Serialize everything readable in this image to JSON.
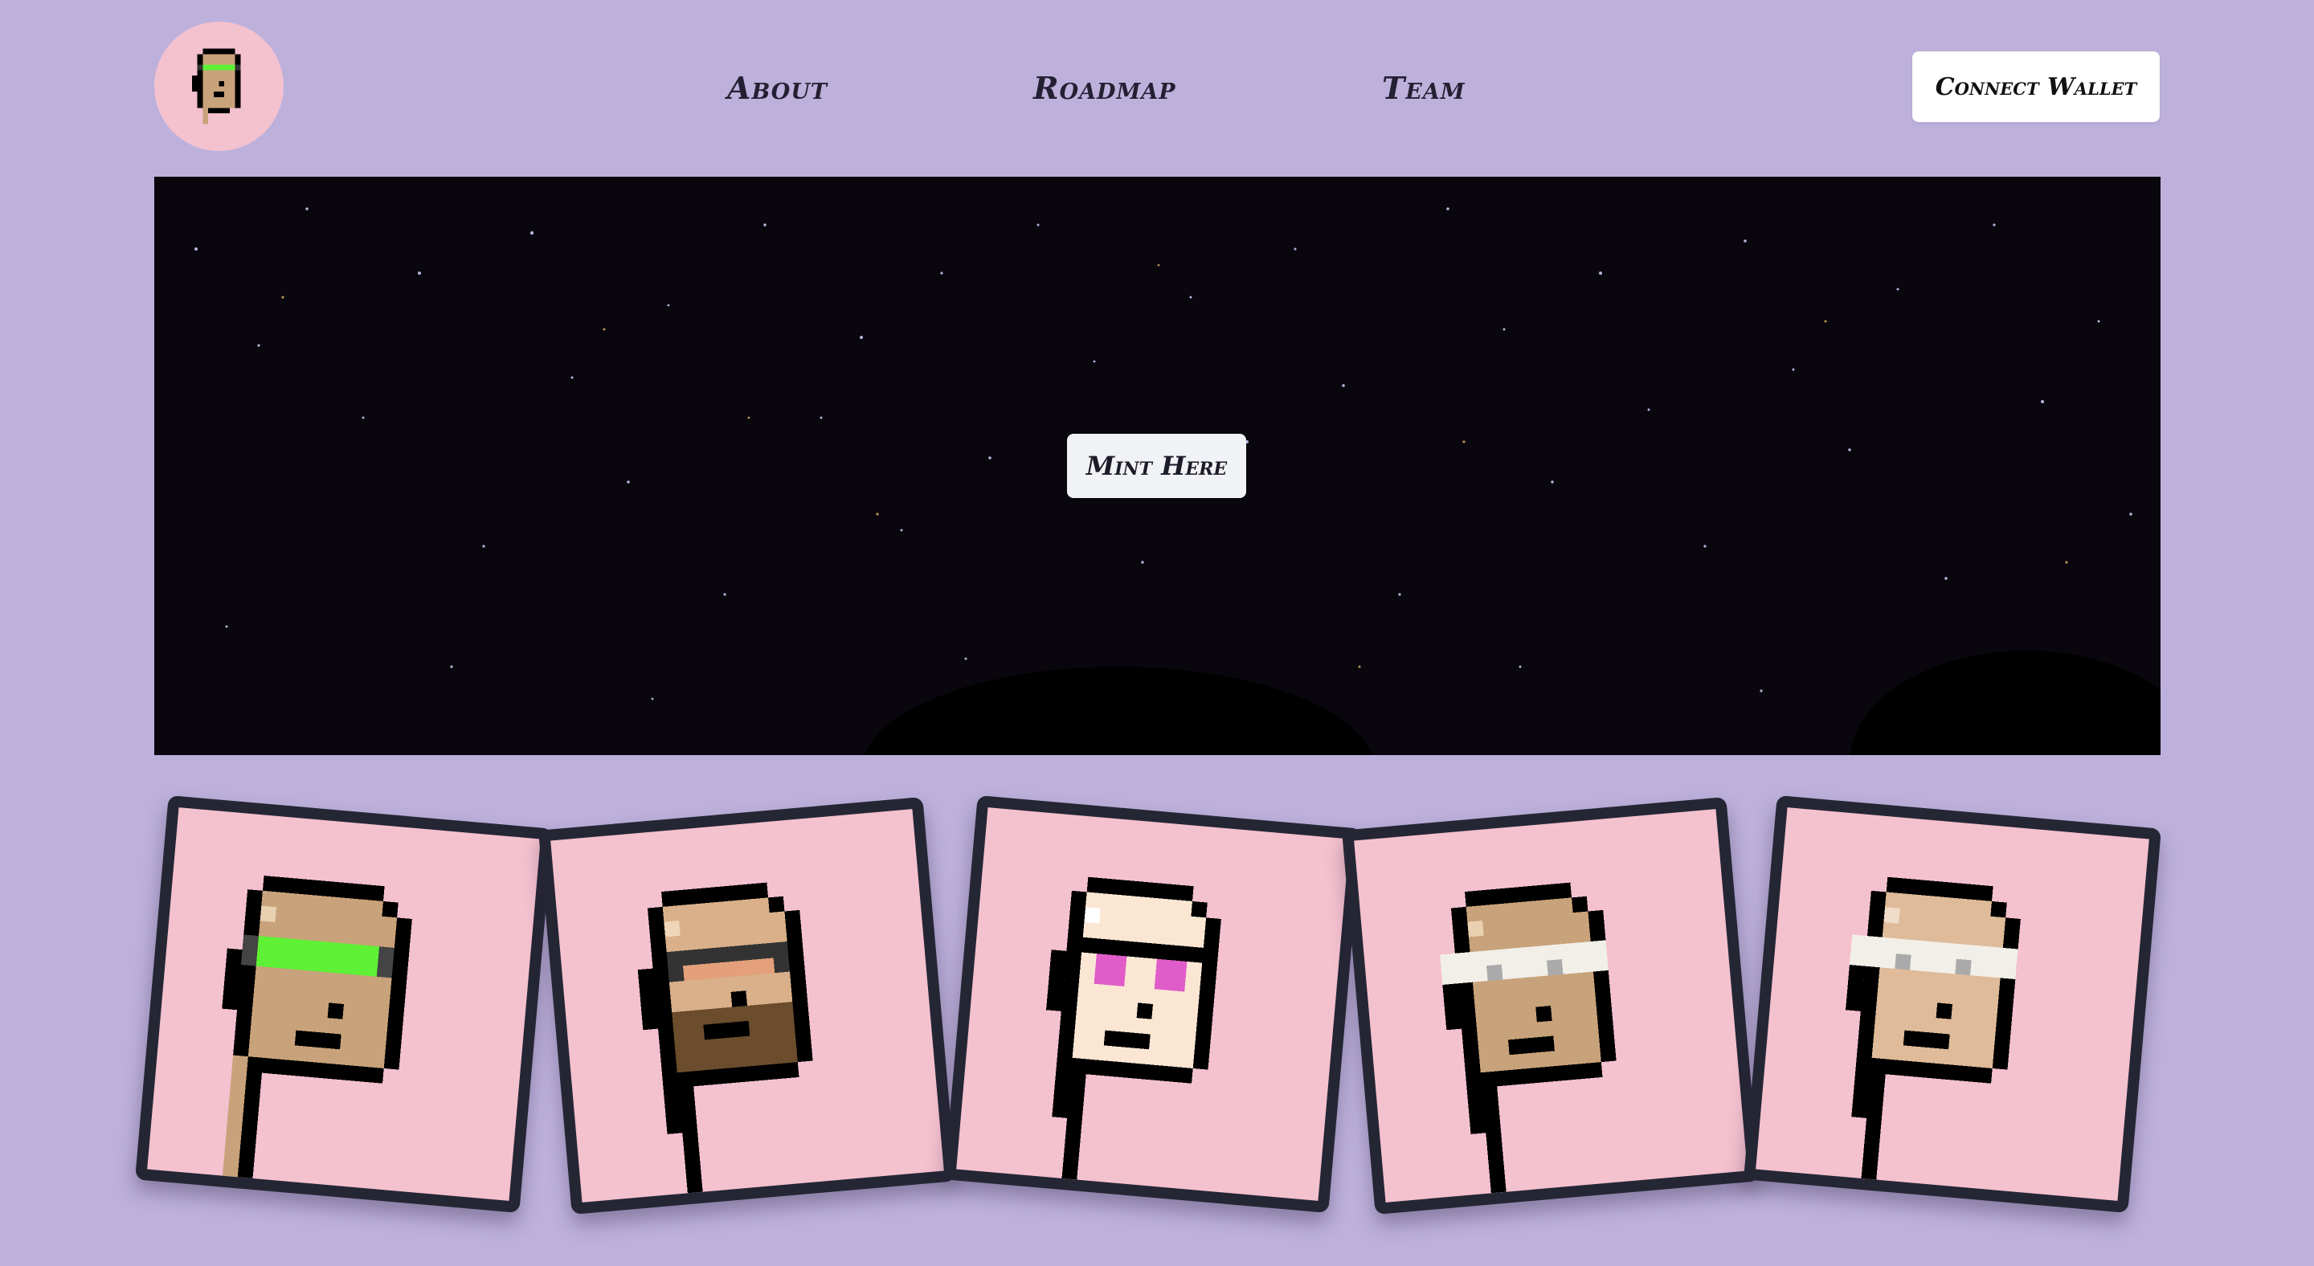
{
  "header": {
    "logo_icon": "pixel-punk-avatar-icon",
    "nav": [
      {
        "label": "About"
      },
      {
        "label": "Roadmap"
      },
      {
        "label": "Team"
      }
    ],
    "connect_label": "Connect Wallet"
  },
  "hero": {
    "background": "starry-night-sky",
    "mint_label": "Mint Here"
  },
  "gallery": {
    "cards": [
      {
        "name": "punk-green-visor",
        "skin": "#c8a27a",
        "eyewear": "green-visor",
        "eyewear_color": "#5ef135",
        "beard": false
      },
      {
        "name": "punk-beard-shades",
        "skin": "#d9b08a",
        "eyewear": "orange-shades",
        "eyewear_color": "#e3a07a",
        "beard": true
      },
      {
        "name": "punk-pink-glasses",
        "skin": "#fbe6d4",
        "eyewear": "pink-glasses",
        "eyewear_color": "#e05cc8",
        "beard": false
      },
      {
        "name": "punk-flower-crown",
        "skin": "#c8a27a",
        "eyewear": "white-crown",
        "eyewear_color": "#ffffff",
        "beard": false
      },
      {
        "name": "punk-flower-crown-light",
        "skin": "#dfbb9a",
        "eyewear": "white-crown",
        "eyewear_color": "#ffffff",
        "beard": false
      }
    ]
  },
  "colors": {
    "page_bg": "#bdb1dc",
    "hero_bg": "#0a060d",
    "card_bg": "#f4c1cf",
    "card_border": "#252634",
    "button_bg": "#ffffff",
    "text": "#242033"
  }
}
